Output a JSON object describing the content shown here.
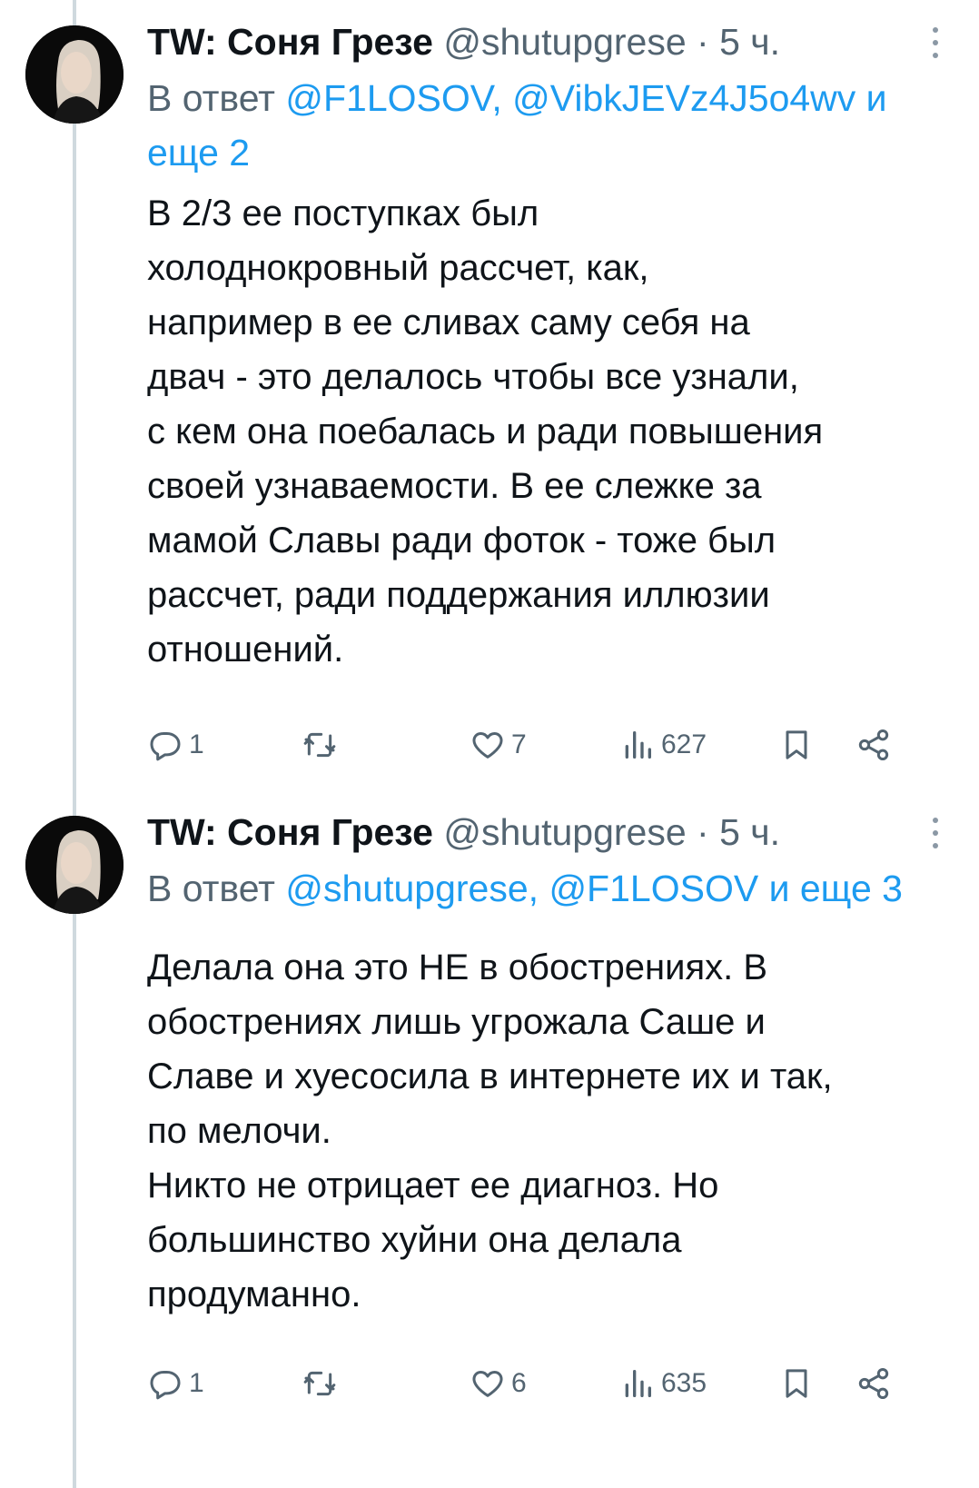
{
  "tweets": [
    {
      "display_name": "TW: Соня Грезе",
      "handle": "@shutupgrese",
      "separator": "·",
      "time": "5 ч.",
      "reply_prefix": "В ответ",
      "reply_mentions": "@F1LOSOV, @VibkJEVz4J5o4wv и еще 2",
      "text": "В 2/3 ее поступках был\nхолоднокровный рассчет, как,\nнапример в ее сливах саму себя на\nдвач - это делалось чтобы все узнали,\nс кем она поебалась и ради повышения\nсвоей узнаваемости. В ее слежке за\nмамой Славы ради фоток - тоже был\nрассчет, ради поддержания иллюзии\nотношений.",
      "replies": "1",
      "retweets": "",
      "likes": "7",
      "views": "627"
    },
    {
      "display_name": "TW: Соня Грезе",
      "handle": "@shutupgrese",
      "separator": "·",
      "time": "5 ч.",
      "reply_prefix": "В ответ",
      "reply_mentions": "@shutupgrese, @F1LOSOV и еще 3",
      "text": "Делала она это НЕ в обострениях. В\nобострениях лишь угрожала Саше и\nСлаве и хуесосила в интернете их и так,\nпо мелочи.\nНикто не отрицает ее диагноз. Но\nбольшинство хуйни она делала\nпродуманно.",
      "replies": "1",
      "retweets": "",
      "likes": "6",
      "views": "635"
    }
  ],
  "icons": {
    "reply": "reply-icon",
    "retweet": "retweet-icon",
    "like": "heart-icon",
    "views": "views-icon",
    "bookmark": "bookmark-icon",
    "share": "share-icon",
    "more": "more-icon"
  },
  "colors": {
    "link": "#1d9bf0",
    "secondary_text": "#536471",
    "primary_text": "#0f1419",
    "thread_line": "#cfd9de"
  }
}
